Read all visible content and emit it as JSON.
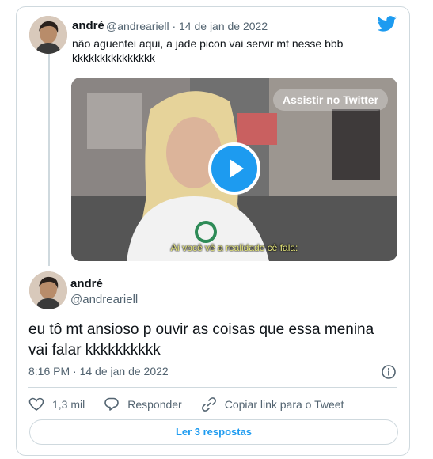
{
  "quoted": {
    "author_name": "andré",
    "meta": "@andreariell · 14 de jan de 2022",
    "text_lines": [
      "não aguentei aqui, a jade picon vai servir mt nesse bbb",
      "kkkkkkkkkkkkkkk"
    ],
    "video": {
      "watch_label": "Assistir no Twitter",
      "caption": "Aí você vê a realidade cê fala:"
    }
  },
  "main": {
    "author_name": "andré",
    "handle": "@andreariell",
    "text_lines": [
      "eu tô mt ansioso p ouvir as coisas que essa menina",
      "vai falar kkkkkkkkkk"
    ],
    "timestamp": "8:16 PM · 14 de jan de 2022"
  },
  "actions": {
    "like_count": "1,3 mil",
    "reply_label": "Responder",
    "copy_label": "Copiar link para o Tweet"
  },
  "read_replies_label": "Ler 3 respostas",
  "colors": {
    "brand": "#1d9bf0",
    "text": "#0f1419",
    "muted": "#536471",
    "border": "#cfd9de"
  },
  "icons": [
    "twitter-bird-icon",
    "play-icon",
    "info-icon",
    "heart-icon",
    "reply-icon",
    "link-icon"
  ]
}
